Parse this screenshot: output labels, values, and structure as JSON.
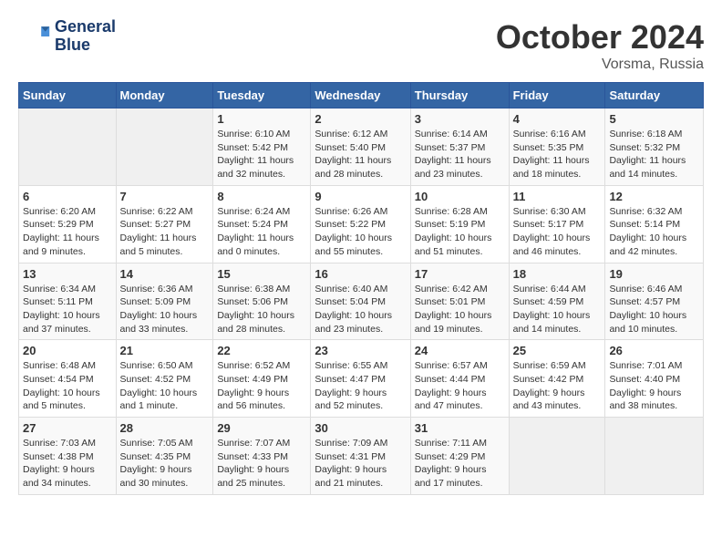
{
  "header": {
    "logo_line1": "General",
    "logo_line2": "Blue",
    "month": "October 2024",
    "location": "Vorsma, Russia"
  },
  "weekdays": [
    "Sunday",
    "Monday",
    "Tuesday",
    "Wednesday",
    "Thursday",
    "Friday",
    "Saturday"
  ],
  "weeks": [
    [
      {
        "day": "",
        "info": ""
      },
      {
        "day": "",
        "info": ""
      },
      {
        "day": "1",
        "info": "Sunrise: 6:10 AM\nSunset: 5:42 PM\nDaylight: 11 hours\nand 32 minutes."
      },
      {
        "day": "2",
        "info": "Sunrise: 6:12 AM\nSunset: 5:40 PM\nDaylight: 11 hours\nand 28 minutes."
      },
      {
        "day": "3",
        "info": "Sunrise: 6:14 AM\nSunset: 5:37 PM\nDaylight: 11 hours\nand 23 minutes."
      },
      {
        "day": "4",
        "info": "Sunrise: 6:16 AM\nSunset: 5:35 PM\nDaylight: 11 hours\nand 18 minutes."
      },
      {
        "day": "5",
        "info": "Sunrise: 6:18 AM\nSunset: 5:32 PM\nDaylight: 11 hours\nand 14 minutes."
      }
    ],
    [
      {
        "day": "6",
        "info": "Sunrise: 6:20 AM\nSunset: 5:29 PM\nDaylight: 11 hours\nand 9 minutes."
      },
      {
        "day": "7",
        "info": "Sunrise: 6:22 AM\nSunset: 5:27 PM\nDaylight: 11 hours\nand 5 minutes."
      },
      {
        "day": "8",
        "info": "Sunrise: 6:24 AM\nSunset: 5:24 PM\nDaylight: 11 hours\nand 0 minutes."
      },
      {
        "day": "9",
        "info": "Sunrise: 6:26 AM\nSunset: 5:22 PM\nDaylight: 10 hours\nand 55 minutes."
      },
      {
        "day": "10",
        "info": "Sunrise: 6:28 AM\nSunset: 5:19 PM\nDaylight: 10 hours\nand 51 minutes."
      },
      {
        "day": "11",
        "info": "Sunrise: 6:30 AM\nSunset: 5:17 PM\nDaylight: 10 hours\nand 46 minutes."
      },
      {
        "day": "12",
        "info": "Sunrise: 6:32 AM\nSunset: 5:14 PM\nDaylight: 10 hours\nand 42 minutes."
      }
    ],
    [
      {
        "day": "13",
        "info": "Sunrise: 6:34 AM\nSunset: 5:11 PM\nDaylight: 10 hours\nand 37 minutes."
      },
      {
        "day": "14",
        "info": "Sunrise: 6:36 AM\nSunset: 5:09 PM\nDaylight: 10 hours\nand 33 minutes."
      },
      {
        "day": "15",
        "info": "Sunrise: 6:38 AM\nSunset: 5:06 PM\nDaylight: 10 hours\nand 28 minutes."
      },
      {
        "day": "16",
        "info": "Sunrise: 6:40 AM\nSunset: 5:04 PM\nDaylight: 10 hours\nand 23 minutes."
      },
      {
        "day": "17",
        "info": "Sunrise: 6:42 AM\nSunset: 5:01 PM\nDaylight: 10 hours\nand 19 minutes."
      },
      {
        "day": "18",
        "info": "Sunrise: 6:44 AM\nSunset: 4:59 PM\nDaylight: 10 hours\nand 14 minutes."
      },
      {
        "day": "19",
        "info": "Sunrise: 6:46 AM\nSunset: 4:57 PM\nDaylight: 10 hours\nand 10 minutes."
      }
    ],
    [
      {
        "day": "20",
        "info": "Sunrise: 6:48 AM\nSunset: 4:54 PM\nDaylight: 10 hours\nand 5 minutes."
      },
      {
        "day": "21",
        "info": "Sunrise: 6:50 AM\nSunset: 4:52 PM\nDaylight: 10 hours\nand 1 minute."
      },
      {
        "day": "22",
        "info": "Sunrise: 6:52 AM\nSunset: 4:49 PM\nDaylight: 9 hours\nand 56 minutes."
      },
      {
        "day": "23",
        "info": "Sunrise: 6:55 AM\nSunset: 4:47 PM\nDaylight: 9 hours\nand 52 minutes."
      },
      {
        "day": "24",
        "info": "Sunrise: 6:57 AM\nSunset: 4:44 PM\nDaylight: 9 hours\nand 47 minutes."
      },
      {
        "day": "25",
        "info": "Sunrise: 6:59 AM\nSunset: 4:42 PM\nDaylight: 9 hours\nand 43 minutes."
      },
      {
        "day": "26",
        "info": "Sunrise: 7:01 AM\nSunset: 4:40 PM\nDaylight: 9 hours\nand 38 minutes."
      }
    ],
    [
      {
        "day": "27",
        "info": "Sunrise: 7:03 AM\nSunset: 4:38 PM\nDaylight: 9 hours\nand 34 minutes."
      },
      {
        "day": "28",
        "info": "Sunrise: 7:05 AM\nSunset: 4:35 PM\nDaylight: 9 hours\nand 30 minutes."
      },
      {
        "day": "29",
        "info": "Sunrise: 7:07 AM\nSunset: 4:33 PM\nDaylight: 9 hours\nand 25 minutes."
      },
      {
        "day": "30",
        "info": "Sunrise: 7:09 AM\nSunset: 4:31 PM\nDaylight: 9 hours\nand 21 minutes."
      },
      {
        "day": "31",
        "info": "Sunrise: 7:11 AM\nSunset: 4:29 PM\nDaylight: 9 hours\nand 17 minutes."
      },
      {
        "day": "",
        "info": ""
      },
      {
        "day": "",
        "info": ""
      }
    ]
  ]
}
